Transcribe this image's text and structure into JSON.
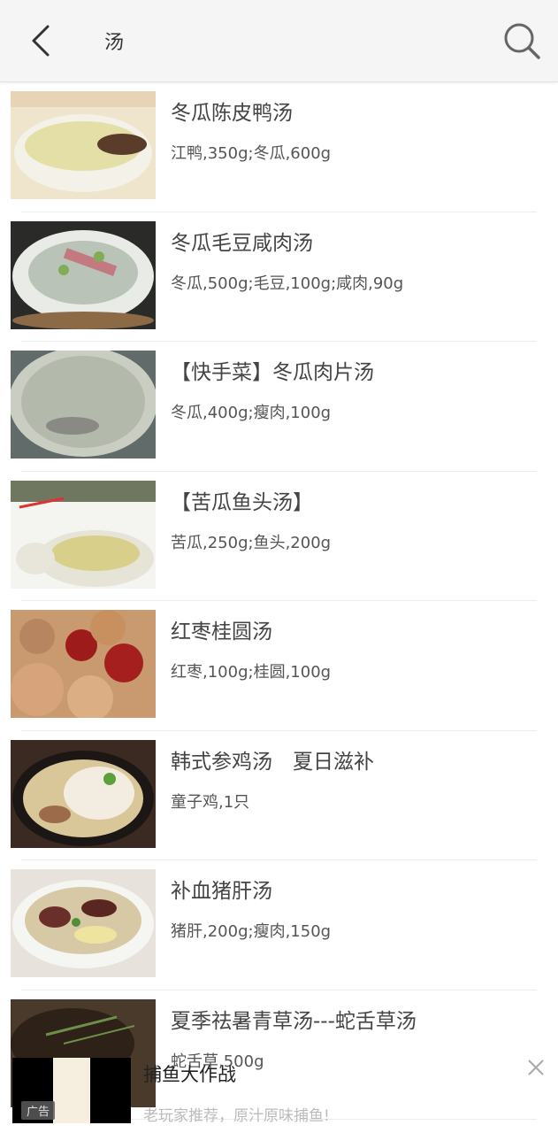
{
  "header": {
    "title": "汤",
    "back_icon": "chevron-left-icon",
    "search_icon": "search-icon"
  },
  "recipes": [
    {
      "title": "冬瓜陈皮鸭汤",
      "ingredients": "江鸭,350g;冬瓜,600g"
    },
    {
      "title": "冬瓜毛豆咸肉汤",
      "ingredients": "冬瓜,500g;毛豆,100g;咸肉,90g"
    },
    {
      "title": "【快手菜】冬瓜肉片汤",
      "ingredients": "冬瓜,400g;瘦肉,100g"
    },
    {
      "title": "【苦瓜鱼头汤】",
      "ingredients": "苦瓜,250g;鱼头,200g"
    },
    {
      "title": "红枣桂圆汤",
      "ingredients": "红枣,100g;桂圆,100g"
    },
    {
      "title": "韩式参鸡汤　夏日滋补",
      "ingredients": "童子鸡,1只"
    },
    {
      "title": "补血猪肝汤",
      "ingredients": "猪肝,200g;瘦肉,150g"
    },
    {
      "title": "夏季祛暑青草汤---蛇舌草汤",
      "ingredients": "蛇舌草,500g"
    }
  ],
  "ad": {
    "badge": "广告",
    "title": "捕鱼大作战",
    "description": "老玩家推荐，原汁原味捕鱼!",
    "close_icon": "close-icon"
  },
  "colors": {
    "header_bg": "#f5f5f5",
    "text_primary": "#444444",
    "divider": "#ececec"
  }
}
